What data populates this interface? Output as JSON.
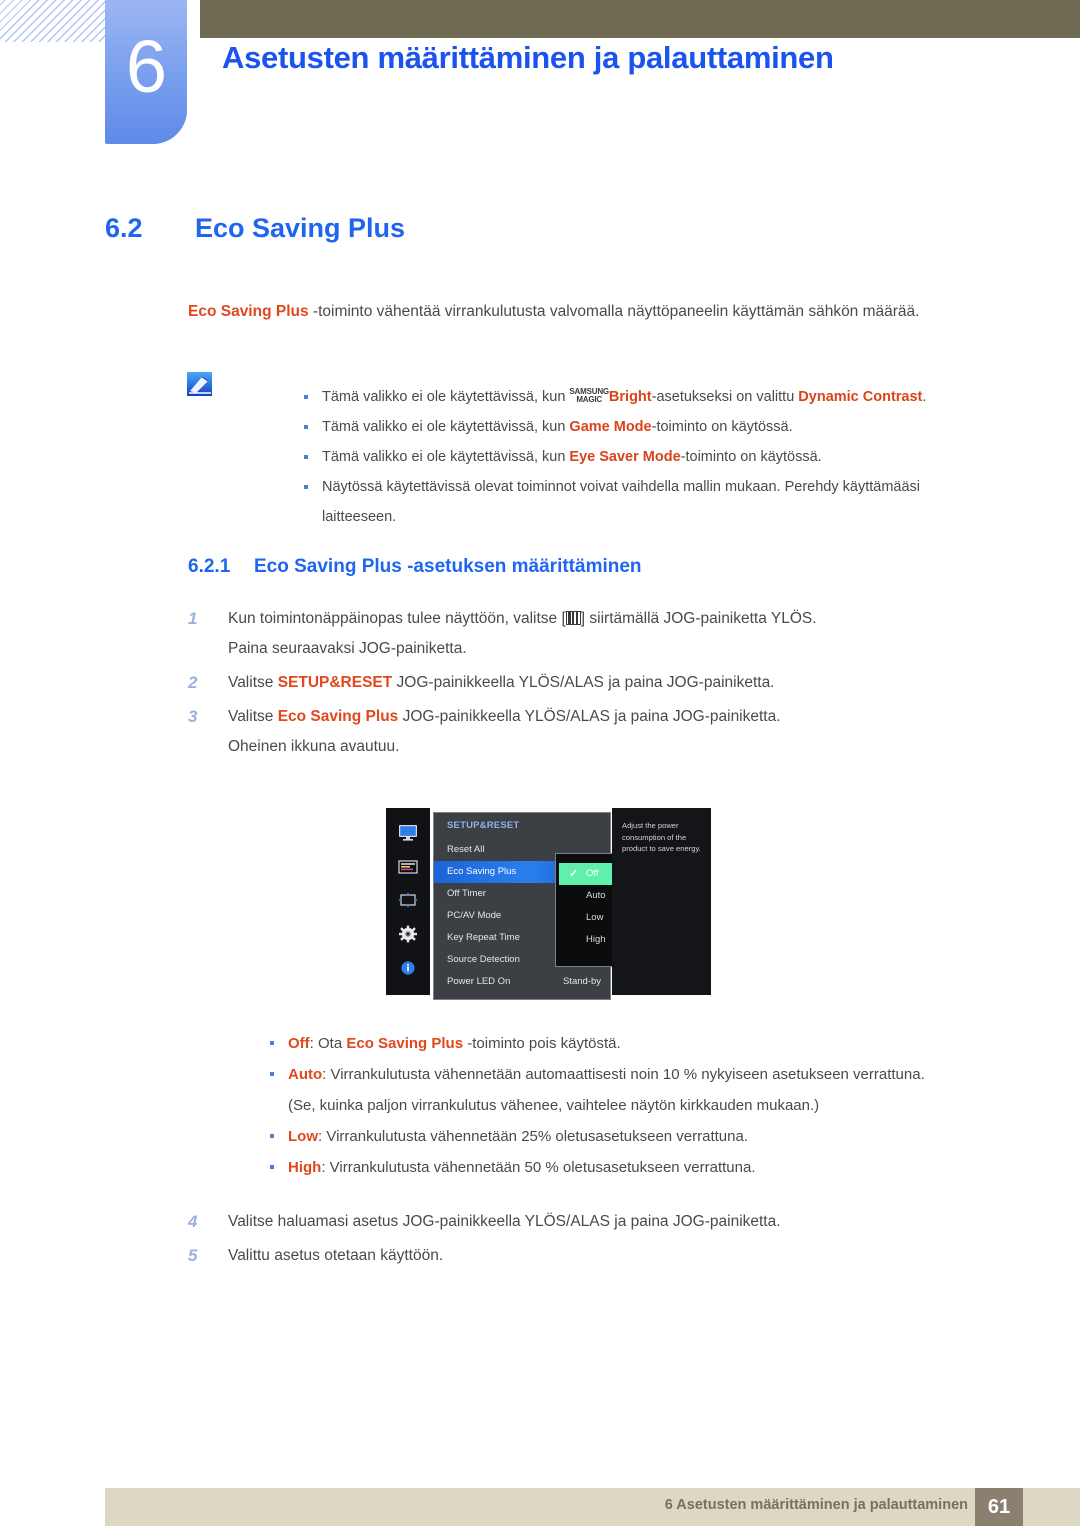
{
  "header": {
    "chapter_number": "6",
    "chapter_title": "Asetusten määrittäminen ja palauttaminen"
  },
  "section": {
    "number": "6.2",
    "title": "Eco Saving Plus"
  },
  "intro": {
    "term": "Eco Saving Plus",
    "rest": " -toiminto vähentää virrankulutusta valvomalla näyttöpaneelin käyttämän sähkön määrää."
  },
  "note": {
    "icon": "note-pencil-icon",
    "bullets": [
      {
        "pre": "Tämä valikko ei ole käytettävissä, kun ",
        "magic_top": "SAMSUNG",
        "magic_bottom": "MAGIC",
        "term1": "Bright",
        "mid": "-asetukseksi on valittu ",
        "term2": "Dynamic Contrast",
        "post": "."
      },
      {
        "pre": "Tämä valikko ei ole käytettävissä, kun ",
        "term1": "Game Mode",
        "post": "-toiminto on käytössä."
      },
      {
        "pre": "Tämä valikko ei ole käytettävissä, kun ",
        "term1": "Eye Saver Mode",
        "post": "-toiminto on käytössä."
      },
      {
        "pre": "Näytössä käytettävissä olevat toiminnot voivat vaihdella mallin mukaan. Perehdy käyttämääsi laitteeseen.",
        "term1": "",
        "post": ""
      }
    ]
  },
  "subsection": {
    "number": "6.2.1",
    "title": "Eco Saving Plus -asetuksen määrittäminen"
  },
  "steps": [
    {
      "n": "1",
      "pre": "Kun toimintonäppäinopas tulee näyttöön, valitse [",
      "glyph": "menu-bars-icon",
      "post": "] siirtämällä JOG-painiketta YLÖS.",
      "line2": "Paina seuraavaksi JOG-painiketta."
    },
    {
      "n": "2",
      "pre": "Valitse ",
      "term": "SETUP&RESET",
      "post": " JOG-painikkeella YLÖS/ALAS ja paina JOG-painiketta."
    },
    {
      "n": "3",
      "pre": "Valitse ",
      "term": "Eco Saving Plus",
      "post": " JOG-painikkeella YLÖS/ALAS ja paina JOG-painiketta.",
      "line2": "Oheinen ikkuna avautuu."
    }
  ],
  "osd": {
    "title": "SETUP&RESET",
    "sidebar_icons": [
      "monitor-icon",
      "picture-settings-icon",
      "screen-adjust-icon",
      "gear-icon",
      "info-icon"
    ],
    "items": [
      {
        "label": "Reset All",
        "value": "",
        "selected": false
      },
      {
        "label": "Eco Saving Plus",
        "value": "",
        "selected": true
      },
      {
        "label": "Off Timer",
        "value": "",
        "selected": false
      },
      {
        "label": "PC/AV Mode",
        "value": "",
        "selected": false
      },
      {
        "label": "Key Repeat Time",
        "value": "",
        "selected": false
      },
      {
        "label": "Source Detection",
        "value": "",
        "selected": false
      },
      {
        "label": "Power LED On",
        "value": "Stand-by",
        "selected": false
      }
    ],
    "options": [
      {
        "label": "Off",
        "checked": true
      },
      {
        "label": "Auto",
        "checked": false
      },
      {
        "label": "Low",
        "checked": false
      },
      {
        "label": "High",
        "checked": false
      }
    ],
    "description": "Adjust the power consumption of the product to save energy.",
    "colors": {
      "highlight_blue": "#2a7ff0",
      "option_green": "#5ff0ad",
      "panel_bg": "#3c4045",
      "sidebar_bg": "#111215"
    }
  },
  "option_descriptions": [
    {
      "term": "Off",
      "sep": ": Ota ",
      "term2": "Eco Saving Plus",
      "post": " -toiminto pois käytöstä."
    },
    {
      "term": "Auto",
      "sep": ": Virrankulutusta vähennetään automaattisesti noin 10 % nykyiseen asetukseen verrattuna.",
      "term2": "",
      "post": "",
      "sub": "(Se, kuinka paljon virrankulutus vähenee, vaihtelee näytön kirkkauden mukaan.)"
    },
    {
      "term": "Low",
      "sep": ": Virrankulutusta vähennetään 25% oletusasetukseen verrattuna.",
      "term2": "",
      "post": ""
    },
    {
      "term": "High",
      "sep": ": Virrankulutusta vähennetään 50 % oletusasetukseen verrattuna.",
      "term2": "",
      "post": ""
    }
  ],
  "steps2": [
    {
      "n": "4",
      "pre": "Valitse haluamasi asetus JOG-painikkeella YLÖS/ALAS ja paina JOG-painiketta."
    },
    {
      "n": "5",
      "pre": "Valittu asetus otetaan käyttöön."
    }
  ],
  "footer": {
    "text": "6 Asetusten määrittäminen ja palauttaminen",
    "page": "61"
  }
}
